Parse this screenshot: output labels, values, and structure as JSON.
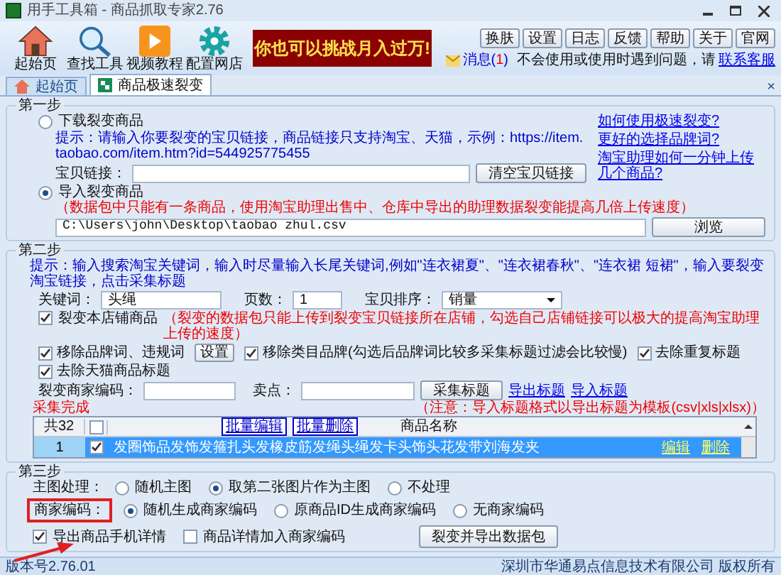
{
  "window": {
    "title": "用手工具箱 - 商品抓取专家2.76"
  },
  "toolbar": {
    "items": [
      {
        "label": "起始页",
        "kind": "home"
      },
      {
        "label": "查找工具",
        "kind": "search"
      },
      {
        "label": "视频教程",
        "kind": "video"
      },
      {
        "label": "配置网店",
        "kind": "settings"
      }
    ],
    "banner": "你也可以挑战月入过万!",
    "buttons": [
      "换肤",
      "设置",
      "日志",
      "反馈",
      "帮助",
      "关于",
      "官网"
    ],
    "message": {
      "label": "消息(",
      "count": "1",
      "suffix": ")"
    },
    "help_text": "不会使用或使用时遇到问题，请",
    "help_link": "联系客服"
  },
  "tabs": [
    {
      "label": "起始页",
      "selected": false,
      "kind": "home"
    },
    {
      "label": "商品极速裂变",
      "selected": true,
      "kind": "split"
    }
  ],
  "tab_close": "×",
  "step1": {
    "title": "第一步",
    "download": {
      "label": "下载裂变商品",
      "selected": false
    },
    "hint": "提示：请输入你要裂变的宝贝链接，商品链接只支持淘宝、天猫，示例：https://item.taobao.com/item.htm?id=544925775455",
    "link_label": "宝贝链接：",
    "clear_button": "清空宝贝链接",
    "import": {
      "label": "导入裂变商品",
      "selected": true
    },
    "import_note": "（数据包中只能有一条商品，使用淘宝助理出售中、仓库中导出的助理数据裂变能提高几倍上传速度）",
    "path": "C:\\Users\\john\\Desktop\\taobao zhul.csv",
    "browse_button": "浏览",
    "help_links": [
      "如何使用极速裂变?",
      "更好的选择品牌词?",
      "淘宝助理如何一分钟上传几个商品?"
    ]
  },
  "step2": {
    "title": "第二步",
    "hint": "提示：输入搜索淘宝关键词，输入时尽量输入长尾关键词,例如\"连衣裙夏\"、\"连衣裙春秋\"、\"连衣裙 短裙\"，输入要裂变淘宝链接，点击采集标题",
    "keyword_label": "关键词：",
    "keyword": "头绳",
    "pages_label": "页数：",
    "pages": "1",
    "sort_label": "宝贝排序：",
    "sort": "销量",
    "shop_only": {
      "label": "裂变本店铺商品",
      "checked": true
    },
    "shop_note": "（裂变的数据包只能上传到裂变宝贝链接所在店铺，勾选自己店铺链接可以极大的提高淘宝助理上传的速度）",
    "options": [
      {
        "label": "移除品牌词、违规词",
        "checked": true,
        "kind": "with_button"
      },
      {
        "label": "移除类目品牌(勾选后品牌词比较多采集标题过滤会比较慢)",
        "checked": true,
        "kind": "plain"
      },
      {
        "label": "去除重复标题",
        "checked": true,
        "kind": "plain"
      },
      {
        "label": "去除天猫商品标题",
        "checked": true,
        "kind": "plain"
      }
    ],
    "settings_button": "设置",
    "code_label": "裂变商家编码：",
    "selling_label": "卖点：",
    "collect_button": "采集标题",
    "export_link": "导出标题",
    "import_link": "导入标题",
    "import_note": "（注意：导入标题格式以导出标题为模板(csv|xls|xlsx)）",
    "status": "采集完成",
    "table": {
      "count": "共32",
      "all_checked": false,
      "column": "商品名称",
      "batch_buttons": [
        "批量编辑",
        "批量删除"
      ],
      "rows": [
        {
          "index": "1",
          "checked": true,
          "selected": true,
          "title": "发圈饰品发饰发箍扎头发橡皮筋发绳头绳发卡头饰头花发带刘海发夹",
          "edit": "编辑",
          "delete": "删除"
        }
      ]
    }
  },
  "step3": {
    "title": "第三步",
    "main_image": {
      "label": "主图处理：",
      "options": [
        {
          "label": "随机主图",
          "selected": false
        },
        {
          "label": "取第二张图片作为主图",
          "selected": true
        },
        {
          "label": "不处理",
          "selected": false
        }
      ]
    },
    "merchant_code": {
      "label": "商家编码：",
      "highlighted": true,
      "options": [
        {
          "label": "随机生成商家编码",
          "selected": true
        },
        {
          "label": "原商品ID生成商家编码",
          "selected": false
        },
        {
          "label": "无商家编码",
          "selected": false
        }
      ]
    },
    "checks": [
      {
        "label": "导出商品手机详情",
        "checked": true
      },
      {
        "label": "商品详情加入商家编码",
        "checked": false
      }
    ],
    "annotation_arrow": true,
    "export_button": "裂变并导出数据包"
  },
  "status_bar": {
    "version": "版本号2.76.01",
    "copyright": "深圳市华通易点信息技术有限公司 版权所有"
  }
}
